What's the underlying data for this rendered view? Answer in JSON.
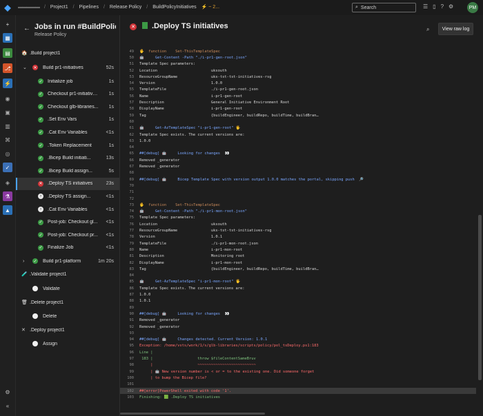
{
  "topbar": {
    "org_blurred": "▬▬▬ ▬▬",
    "crumbs": [
      "Project1",
      "Pipelines",
      "Release Policy",
      "BuildPolicyInitiatives",
      "⚡ ~ 2..."
    ],
    "search_placeholder": "Search",
    "avatar": "PM"
  },
  "left": {
    "title": "Jobs in run #BuildPolicy...",
    "subtitle": "Release Policy",
    "stages": [
      {
        "label": ".Build project1",
        "jobs": [
          {
            "label": "Build pr1-initiatives",
            "duration": "52s",
            "status": "fail",
            "expanded": true,
            "steps": [
              {
                "label": "Initialize job",
                "duration": "1s",
                "status": "success"
              },
              {
                "label": "Checkout pr1-initiatives...",
                "duration": "1s",
                "status": "success"
              },
              {
                "label": "Checkout glb-libraries...",
                "duration": "1s",
                "status": "success"
              },
              {
                "label": ".Set Env Vars",
                "duration": "1s",
                "status": "success"
              },
              {
                "label": ".Cat Env Variables",
                "duration": "<1s",
                "status": "success"
              },
              {
                "label": ".Token Replacement",
                "duration": "1s",
                "status": "success"
              },
              {
                "label": ".Bicep Build initiati...",
                "duration": "13s",
                "status": "success"
              },
              {
                "label": ".Bicep Build assign...",
                "duration": "5s",
                "status": "success"
              },
              {
                "label": ".Deploy TS initiatives",
                "duration": "23s",
                "status": "fail"
              },
              {
                "label": ".Deploy TS assign...",
                "duration": "<1s",
                "status": "skipped"
              },
              {
                "label": ".Cat Env Variables",
                "duration": "<1s",
                "status": "skipped"
              },
              {
                "label": "Post-job: Checkout gl...",
                "duration": "<1s",
                "status": "success"
              },
              {
                "label": "Post-job: Checkout pr...",
                "duration": "<1s",
                "status": "success"
              },
              {
                "label": "Finalize Job",
                "duration": "<1s",
                "status": "success"
              }
            ]
          },
          {
            "label": "Build pr1-platform",
            "duration": "1m 20s",
            "status": "success",
            "expanded": false,
            "steps": []
          }
        ]
      },
      {
        "label": ".Validate project1",
        "jobs": [
          {
            "label": "Validate",
            "status": "pending"
          }
        ]
      },
      {
        "label": ".Delete project1",
        "jobs": [
          {
            "label": "Delete",
            "status": "pending"
          }
        ]
      },
      {
        "label": ".Deploy project1",
        "jobs": [
          {
            "label": "Assign",
            "status": "pending"
          }
        ]
      }
    ]
  },
  "main": {
    "title": ".Deploy TS initiatives",
    "raw_button": "View raw log",
    "lines": [
      {
        "n": "49",
        "t": "🖐  function    Set-ThisTemplateSpec",
        "c": "orange"
      },
      {
        "n": "50",
        "t": "🤖     Get-Content -Path \"./i-pr1-gen-root.json\"",
        "c": "blue"
      },
      {
        "n": "51",
        "t": "Template Spec parameters:",
        "c": ""
      },
      {
        "n": "52",
        "t": "Location                        uksouth",
        "c": ""
      },
      {
        "n": "53",
        "t": "ResourceGroupName               uks-tst-tst-initiatives-rsg",
        "c": ""
      },
      {
        "n": "54",
        "t": "Version                         1.0.0",
        "c": ""
      },
      {
        "n": "55",
        "t": "TemplateFile                    ./i-pr1-gen-root.json",
        "c": ""
      },
      {
        "n": "56",
        "t": "Name                            i-pr1-gen-root",
        "c": ""
      },
      {
        "n": "57",
        "t": "Description                     General Initiative Environment Root",
        "c": ""
      },
      {
        "n": "58",
        "t": "DisplayName                     i-pr1-gen-root",
        "c": ""
      },
      {
        "n": "59",
        "t": "Tag                             {buildEngineer, buildRepo, buildTime, buildBran…",
        "c": ""
      },
      {
        "n": "60",
        "t": "",
        "c": ""
      },
      {
        "n": "61",
        "t": "🤖     Get-AzTemplateSpec \"i-pr1-gen-root\" 🖐",
        "c": "blue"
      },
      {
        "n": "62",
        "t": "Template Spec exists. The current versions are:",
        "c": ""
      },
      {
        "n": "63",
        "t": "1.0.0",
        "c": ""
      },
      {
        "n": "64",
        "t": "",
        "c": ""
      },
      {
        "n": "65",
        "t": "##[debug] 🤖     Looking for changes  👀",
        "c": "blue"
      },
      {
        "n": "66",
        "t": "Removed _generator",
        "c": ""
      },
      {
        "n": "67",
        "t": "Removed _generator",
        "c": ""
      },
      {
        "n": "68",
        "t": "",
        "c": ""
      },
      {
        "n": "69",
        "t": "##[debug] 🤖     Bicep Template Spec with version output 1.0.0 matches the portal, skipping push  🔎",
        "c": "blue"
      },
      {
        "n": "70",
        "t": "",
        "c": ""
      },
      {
        "n": "71",
        "t": "",
        "c": ""
      },
      {
        "n": "72",
        "t": "",
        "c": ""
      },
      {
        "n": "73",
        "t": "🖐  function    Set-ThisTemplateSpec",
        "c": "orange"
      },
      {
        "n": "74",
        "t": "🤖     Get-Content -Path \"./i-pr1-mon-root.json\"",
        "c": "blue"
      },
      {
        "n": "75",
        "t": "Template Spec parameters:",
        "c": ""
      },
      {
        "n": "76",
        "t": "Location                        uksouth",
        "c": ""
      },
      {
        "n": "77",
        "t": "ResourceGroupName               uks-tst-tst-initiatives-rsg",
        "c": ""
      },
      {
        "n": "78",
        "t": "Version                         1.0.1",
        "c": ""
      },
      {
        "n": "79",
        "t": "TemplateFile                    ./i-pr1-mon-root.json",
        "c": ""
      },
      {
        "n": "80",
        "t": "Name                            i-pr1-mon-root",
        "c": ""
      },
      {
        "n": "81",
        "t": "Description                     Monitoring root",
        "c": ""
      },
      {
        "n": "82",
        "t": "DisplayName                     i-pr1-mon-root",
        "c": ""
      },
      {
        "n": "83",
        "t": "Tag                             {buildEngineer, buildRepo, buildTime, buildBran…",
        "c": ""
      },
      {
        "n": "84",
        "t": "",
        "c": ""
      },
      {
        "n": "85",
        "t": "🤖     Get-AzTemplateSpec \"i-pr1-mon-root\" 🖐",
        "c": "blue"
      },
      {
        "n": "86",
        "t": "Template Spec exists. The current versions are:",
        "c": ""
      },
      {
        "n": "87",
        "t": "1.0.0",
        "c": ""
      },
      {
        "n": "88",
        "t": "1.0.1",
        "c": ""
      },
      {
        "n": "89",
        "t": "",
        "c": ""
      },
      {
        "n": "90",
        "t": "##[debug] 🤖     Looking for changes  👀",
        "c": "blue"
      },
      {
        "n": "91",
        "t": "Removed _generator",
        "c": ""
      },
      {
        "n": "92",
        "t": "Removed _generator",
        "c": ""
      },
      {
        "n": "93",
        "t": "",
        "c": ""
      },
      {
        "n": "94",
        "t": "##[debug] 🤖     Changes detected. Current Version: 1.0.1",
        "c": "blue"
      },
      {
        "n": "95",
        "t": "Exception: /home/vsts/work/1/s/glb-libraries/scripts/policy/pol_tsDeploy.ps1:183",
        "c": "red"
      },
      {
        "n": "96",
        "t": "Line |",
        "c": "green"
      },
      {
        "n": "97",
        "t": " 183 |                    throw $fileContentSameBruv",
        "c": "green"
      },
      {
        "n": "98",
        "t": "     |                    ~~~~~~~~~~~~~~~~~~~~~~~~~~",
        "c": "red"
      },
      {
        "n": "99",
        "t": "     | 🤖 New version number is < or = to the existing one. Did someone forget",
        "c": "red"
      },
      {
        "n": "100",
        "t": "     | to bump the Bicep file?",
        "c": "red"
      },
      {
        "n": "101",
        "t": "",
        "c": ""
      },
      {
        "n": "102",
        "t": "##[error]PowerShell exited with code '1'.",
        "c": "red"
      },
      {
        "n": "103",
        "t": "Finishing: 🟩 .Deploy TS initiatives",
        "c": "green"
      }
    ]
  }
}
